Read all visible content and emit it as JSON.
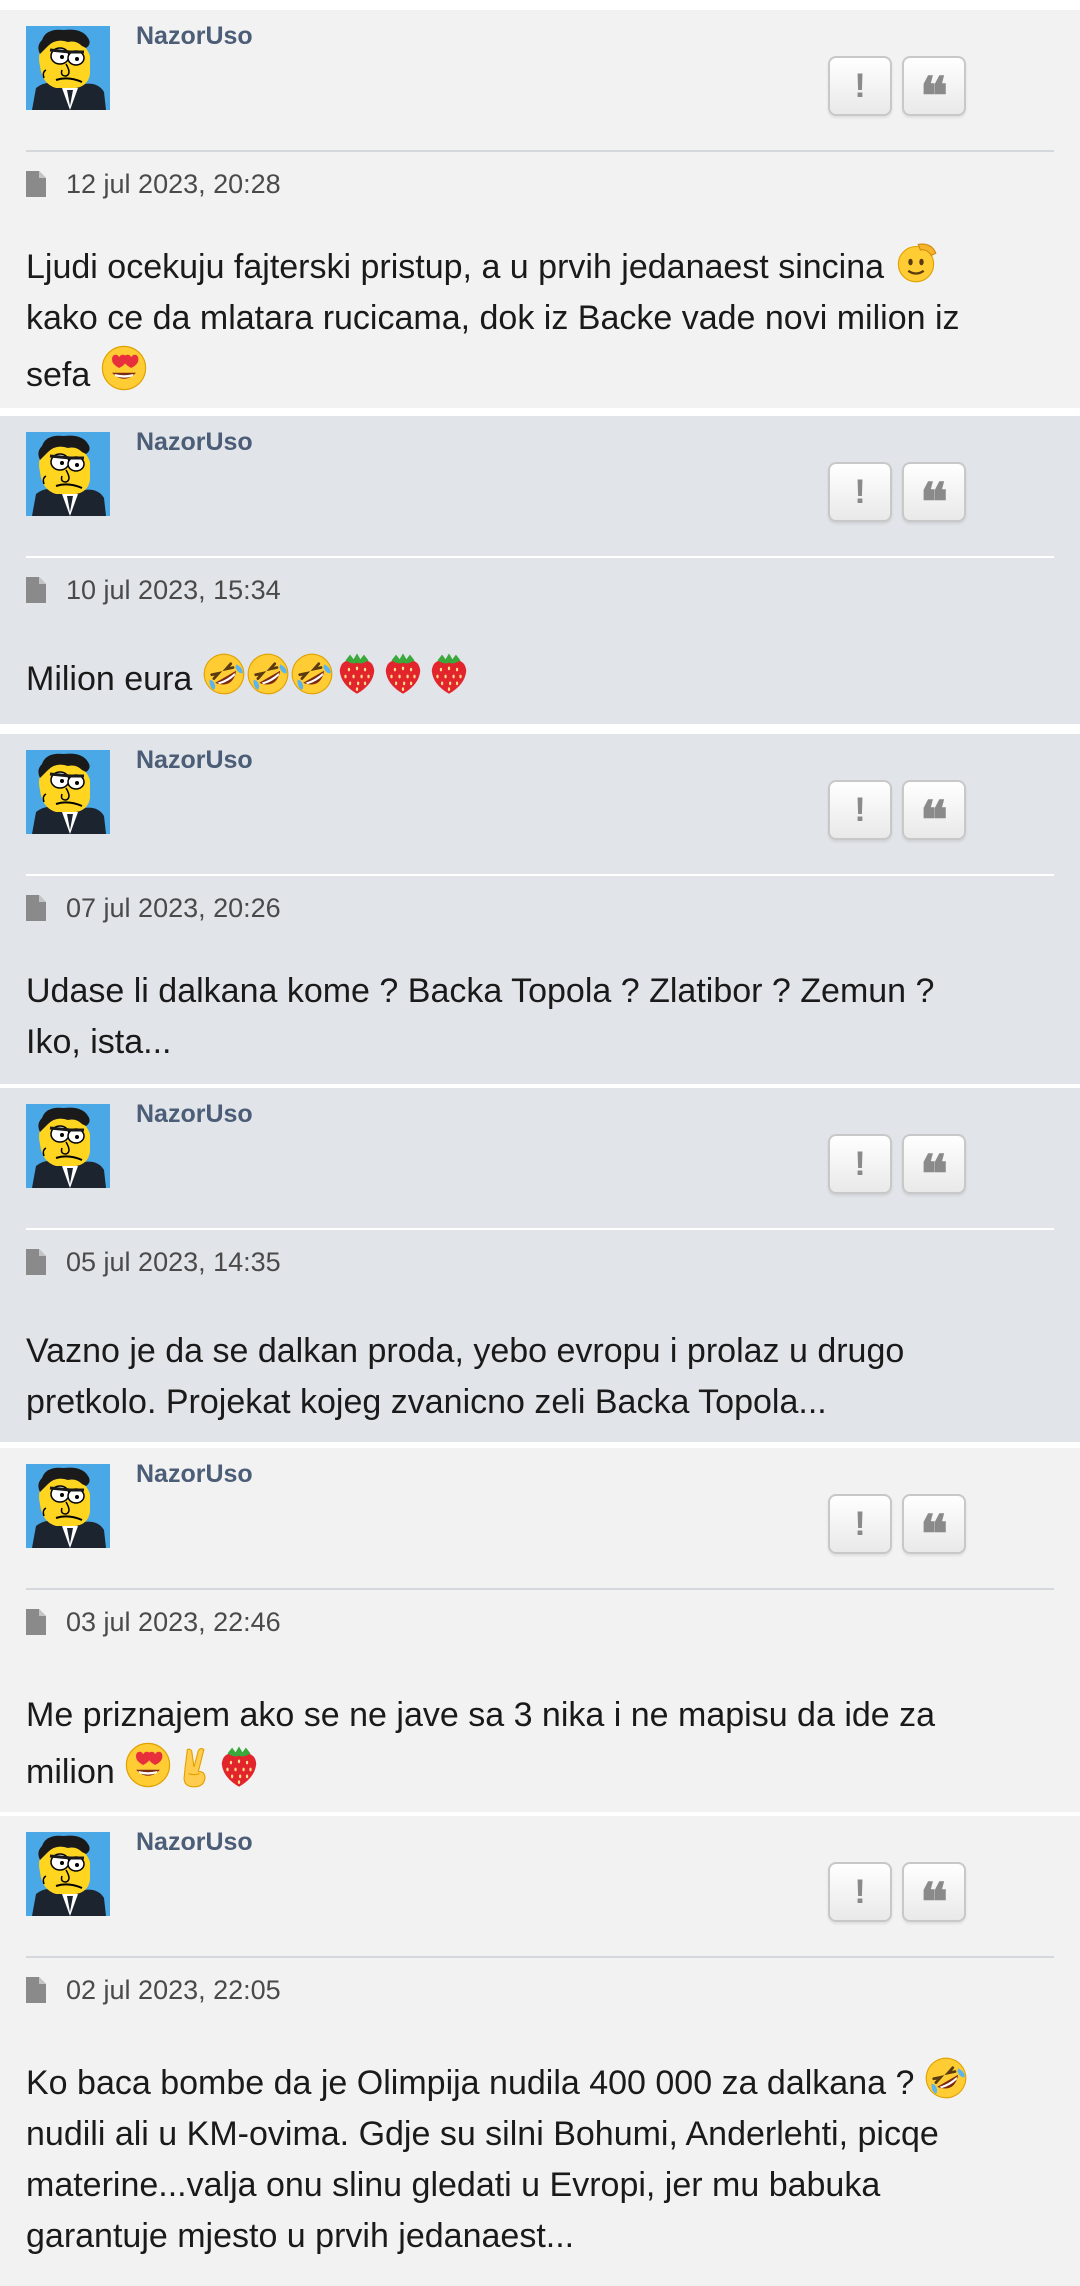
{
  "posts": [
    {
      "author": "NazorUso",
      "date": "12 jul 2023, 20:28",
      "text": "Ljudi ocekuju fajterski pristup, a u prvih jedanaest sincina",
      "text2": "kako ce da mlatara rucicama, dok iz Backe vade novi milion iz",
      "text3": "sefa",
      "emojis": [
        "saluting-face",
        "heart-eyes"
      ]
    },
    {
      "author": "NazorUso",
      "date": "10 jul 2023, 15:34",
      "text": "Milion eura",
      "emojis": [
        "rofl",
        "rofl",
        "rofl",
        "strawberry",
        "strawberry",
        "strawberry"
      ]
    },
    {
      "author": "NazorUso",
      "date": "07 jul 2023, 20:26",
      "text": "Udase li dalkana kome ? Backa Topola ? Zlatibor ? Zemun ?",
      "text2": "Iko, ista..."
    },
    {
      "author": "NazorUso",
      "date": "05 jul 2023, 14:35",
      "text": "Vazno je da se dalkan proda, yebo evropu i prolaz u drugo",
      "text2": "pretkolo. Projekat kojeg zvanicno zeli Backa Topola..."
    },
    {
      "author": "NazorUso",
      "date": "03 jul 2023, 22:46",
      "text": "Me priznajem ako se ne jave sa 3 nika i ne mapisu da ide za",
      "text2": "milion",
      "emojis": [
        "heart-eyes",
        "victory-hand",
        "strawberry"
      ]
    },
    {
      "author": "NazorUso",
      "date": "02 jul 2023, 22:05",
      "text": "Ko baca bombe da je Olimpija nudila 400 000 za dalkana ?",
      "text2": "nudili ali u KM-ovima. Gdje su silni Bohumi, Anderlehti, picqe",
      "text3": "materine...valja onu slinu gledati u Evropi, jer mu babuka",
      "text4": "garantuje mjesto u prvih jedanaest...",
      "emojis": [
        "rofl"
      ]
    }
  ],
  "buttons": {
    "report": "!",
    "quote": "66"
  },
  "colors": {
    "author": "#4c5d77",
    "bg_light": "#f2f2f2",
    "bg_gray": "#e1e4e8"
  }
}
